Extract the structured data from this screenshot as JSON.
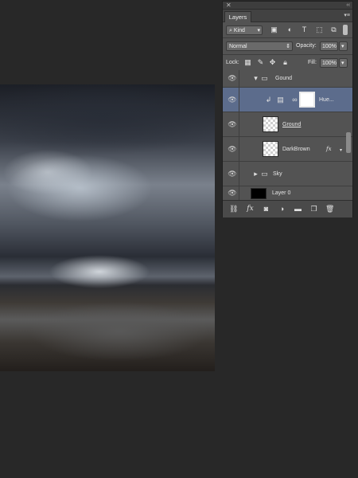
{
  "panel": {
    "close_glyph": "✕",
    "collapse_glyph": "‹‹",
    "tab_label": "Layers",
    "menu_glyph": "▾≡"
  },
  "filter": {
    "kind_label": "Kind",
    "icons": [
      "image-filter-icon",
      "adjustment-filter-icon",
      "type-filter-icon",
      "shape-filter-icon",
      "smart-object-filter-icon"
    ]
  },
  "blend": {
    "mode": "Normal",
    "opacity_label": "Opacity:",
    "opacity_value": "100%"
  },
  "lock": {
    "lock_label": "Lock:",
    "fill_label": "Fill:",
    "fill_value": "100%"
  },
  "layers": [
    {
      "name": "Gound",
      "type": "group",
      "expanded": true
    },
    {
      "name": "Hue...",
      "type": "adjustment",
      "selected": true,
      "clipped": true
    },
    {
      "name": "Ground",
      "type": "pixel"
    },
    {
      "name": "DarkBrown",
      "type": "pixel",
      "has_fx": true,
      "fx_label": "fx"
    },
    {
      "name": "Sky",
      "type": "group",
      "expanded": false
    },
    {
      "name": "Layer 0",
      "type": "pixel",
      "fill": "#000000"
    }
  ],
  "bottom_icons": [
    "link-layers-icon",
    "fx-icon",
    "add-mask-icon",
    "adjustment-layer-icon",
    "new-group-icon",
    "new-layer-icon",
    "delete-icon"
  ],
  "colors": {
    "panel_bg": "#535353",
    "selected_row": "#5c6c8c",
    "workspace_bg": "#282828"
  }
}
